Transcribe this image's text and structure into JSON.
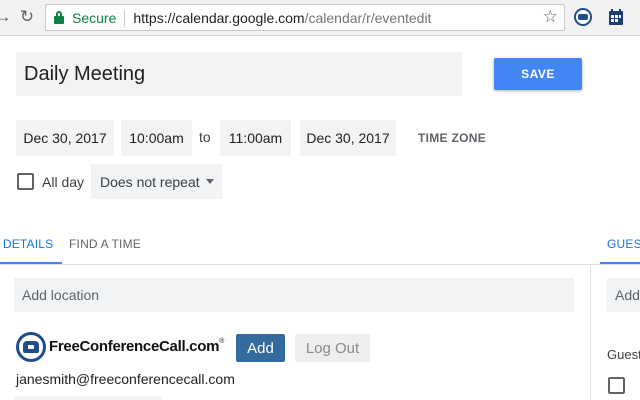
{
  "browser": {
    "secure_label": "Secure",
    "url_host": "https://calendar.google.com",
    "url_path": "/calendar/r/eventedit"
  },
  "event": {
    "title": "Daily Meeting",
    "save_label": "SAVE",
    "start_date": "Dec 30, 2017",
    "start_time": "10:00am",
    "to_label": "to",
    "end_time": "11:00am",
    "end_date": "Dec 30, 2017",
    "timezone_label": "TIME ZONE",
    "all_day_label": "All day",
    "all_day_checked": false,
    "repeat_value": "Does not repeat"
  },
  "tabs": {
    "details": "T DETAILS",
    "find_time": "FIND A TIME",
    "guests": "GUEST"
  },
  "details": {
    "location_placeholder": "Add location"
  },
  "conference": {
    "brand": "FreeConferenceCall.com",
    "reg_mark": "®",
    "add_label": "Add",
    "logout_label": "Log Out",
    "email": "janesmith@freeconferencecall.com"
  },
  "guests_panel": {
    "add_placeholder": "Add",
    "label": "Guest"
  },
  "colors": {
    "accent": "#4285f4",
    "secure_green": "#0b8043",
    "fcc_blue": "#336b9e"
  }
}
